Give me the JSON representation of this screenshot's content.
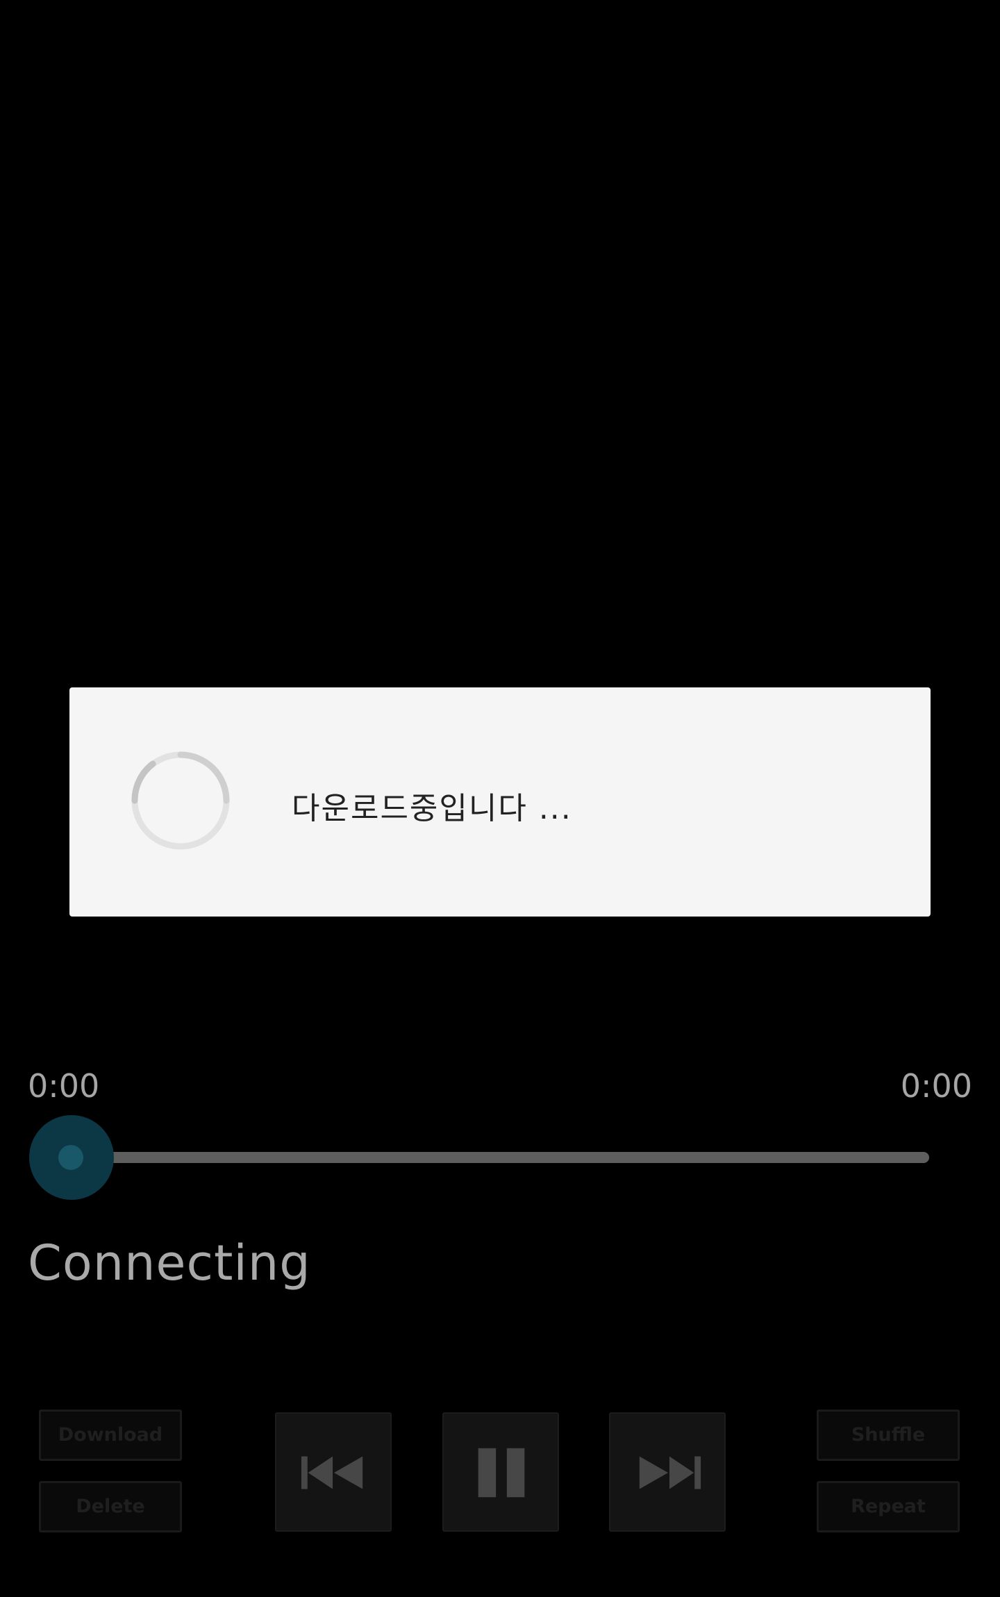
{
  "dialog": {
    "message": "다운로드중입니다 ...",
    "spinner_icon": "loading-spinner-icon"
  },
  "player": {
    "elapsed_time": "0:00",
    "total_time": "0:00",
    "progress": 0,
    "status": "Connecting",
    "accent_color": "#195868"
  },
  "controls": {
    "download_label": "Download",
    "delete_label": "Delete",
    "shuffle_label": "Shuffle",
    "repeat_label": "Repeat",
    "previous_icon": "skip-previous-icon",
    "pause_icon": "pause-icon",
    "next_icon": "skip-next-icon"
  }
}
